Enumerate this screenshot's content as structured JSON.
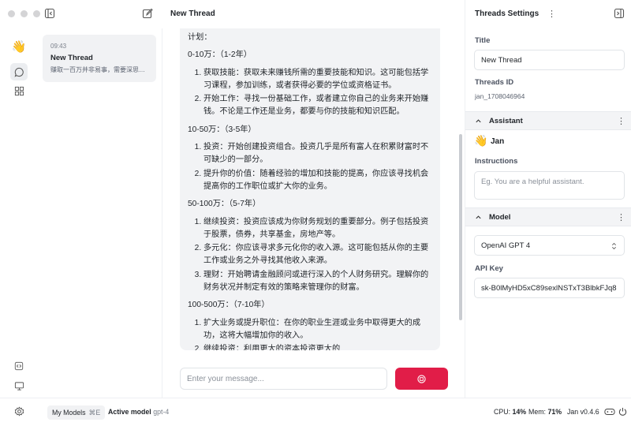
{
  "window": {
    "thread_title": "New Thread",
    "settings_title": "Threads Settings"
  },
  "thread_list": [
    {
      "time": "09:43",
      "title": "New Thread",
      "snippet": "赚取一百万并非易事，需要深思熟虑…"
    }
  ],
  "chat": {
    "sections": [
      {
        "heading": "计划：",
        "items": []
      },
      {
        "heading": "0-10万：（1-2年）",
        "items": [
          "获取技能：获取未来赚钱所需的重要技能和知识。这可能包括学习课程，参加训练，或者获得必要的学位或资格证书。",
          "开始工作：寻找一份基础工作，或者建立你自己的业务来开始赚钱。不论是工作还是业务，都要与你的技能和知识匹配。"
        ]
      },
      {
        "heading": "10-50万：（3-5年）",
        "items": [
          "投资：开始创建投资组合。投资几乎是所有富人在积累财富时不可缺少的一部分。",
          "提升你的价值：随着经验的增加和技能的提高，你应该寻找机会提高你的工作职位或扩大你的业务。"
        ]
      },
      {
        "heading": "50-100万：（5-7年）",
        "items": [
          "继续投资：投资应该成为你财务规划的重要部分。例子包括投资于股票，债券，共享基金，房地产等。",
          "多元化：你应该寻求多元化你的收入源。这可能包括从你的主要工作或业务之外寻找其他收入来源。",
          "理财：开始聘请金融顾问或进行深入的个人财务研究。理解你的财务状况并制定有效的策略来管理你的财富。"
        ]
      },
      {
        "heading": "100-500万：（7-10年）",
        "items": [
          "扩大业务或提升职位：在你的职业生涯或业务中取得更大的成功，这将大幅增加你的收入。",
          "继续投资：利用更大的资本投资更大的"
        ]
      }
    ],
    "input_placeholder": "Enter your message..."
  },
  "settings": {
    "title_label": "Title",
    "title_value": "New Thread",
    "thread_id_label": "Threads ID",
    "thread_id_value": "jan_1708046964",
    "assistant_section": "Assistant",
    "assistant_emoji": "👋",
    "assistant_name": "Jan",
    "instructions_label": "Instructions",
    "instructions_placeholder": "Eg. You are a helpful assistant.",
    "model_section": "Model",
    "model_value": "OpenAI GPT 4",
    "api_key_label": "API Key",
    "api_key_value": "sk-B0lMyHD5xC89sexlNSTxT3BlbkFJq8"
  },
  "statusbar": {
    "my_models": "My Models",
    "shortcut": "⌘E",
    "active_model_label": "Active model",
    "active_model_value": "gpt-4",
    "cpu_label": "CPU:",
    "cpu_value": "14%",
    "mem_label": "Mem:",
    "mem_value": "71%",
    "version": "Jan v0.4.6"
  },
  "colors": {
    "accent": "#e11d48",
    "panel": "#f2f3f5"
  },
  "icons": [
    "sidebar-toggle-icon",
    "edit-icon",
    "more-icon",
    "panel-toggle-icon",
    "wave-emoji",
    "chat-icon",
    "grid-icon",
    "code-icon",
    "monitor-icon",
    "settings-icon",
    "stop-icon",
    "chevron-up-icon",
    "select-arrows-icon",
    "gamepad-icon",
    "power-icon"
  ]
}
